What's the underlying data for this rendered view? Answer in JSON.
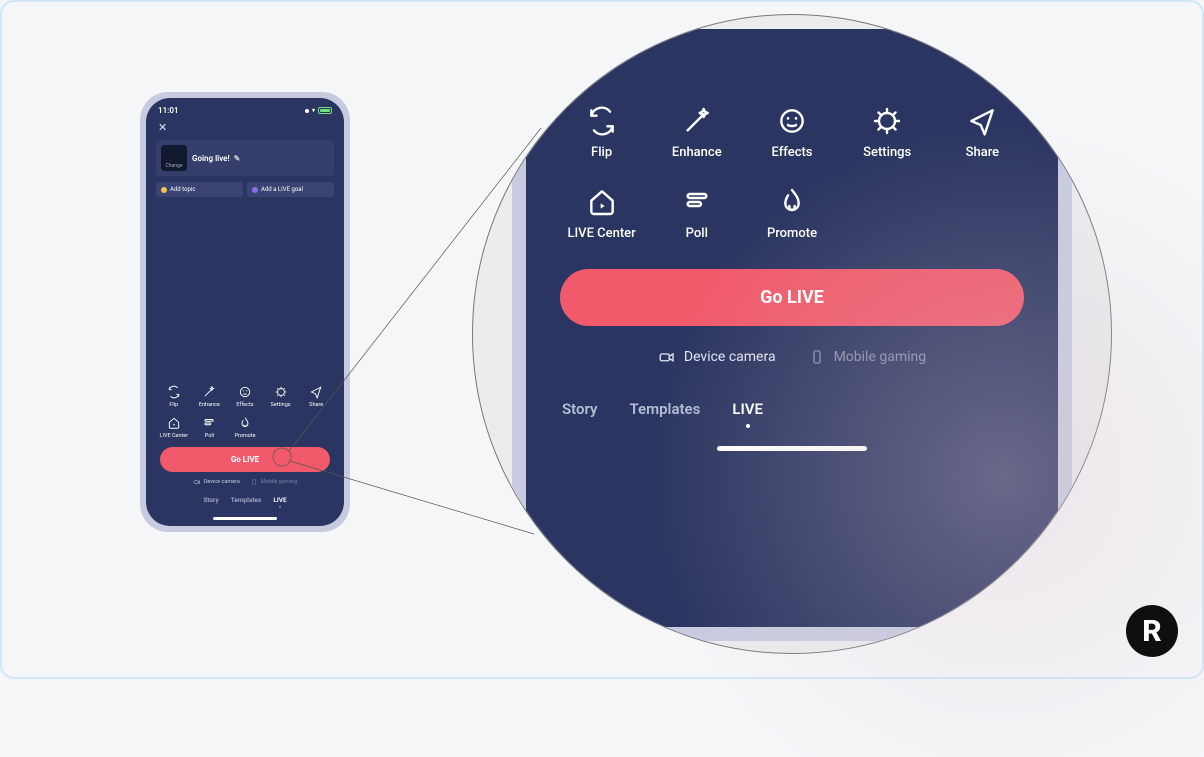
{
  "status": {
    "time": "11:01"
  },
  "title_card": {
    "title": "Going live!",
    "change_label": "Change"
  },
  "chips": {
    "add_topic": "Add topic",
    "add_goal": "Add a LIVE goal"
  },
  "icons": {
    "flip": "Flip",
    "enhance": "Enhance",
    "effects": "Effects",
    "settings": "Settings",
    "share": "Share",
    "live_center": "LIVE Center",
    "poll": "Poll",
    "promote": "Promote"
  },
  "go_live": "Go LIVE",
  "device": {
    "camera": "Device camera",
    "gaming": "Mobile gaming"
  },
  "tabs": {
    "story": "Story",
    "templates": "Templates",
    "live": "LIVE"
  },
  "brand": "R"
}
